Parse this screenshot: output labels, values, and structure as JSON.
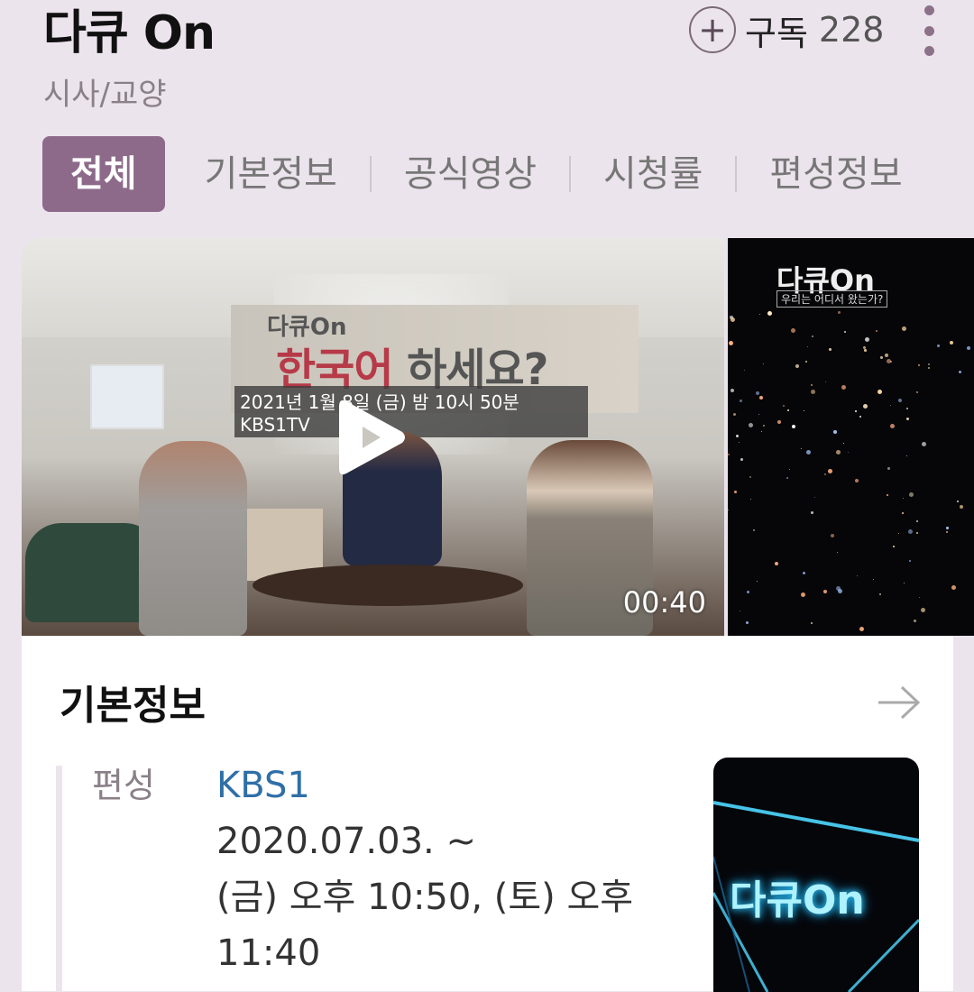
{
  "header": {
    "title": "다큐 On",
    "category": "시사/교양",
    "subscribe_label": "구독",
    "subscribe_count": "228"
  },
  "tabs": [
    {
      "label": "전체",
      "active": true
    },
    {
      "label": "기본정보",
      "active": false
    },
    {
      "label": "공식영상",
      "active": false
    },
    {
      "label": "시청률",
      "active": false
    },
    {
      "label": "편성정보",
      "active": false
    }
  ],
  "videos": [
    {
      "duration": "00:40",
      "sign_logo": "다큐On",
      "sign_title_red": "한국어",
      "sign_title_grey": "하세요?",
      "sign_date": "2021년 1월 8일 (금) 밤 10시 50분 KBS1TV"
    },
    {
      "logo": "다큐On",
      "subtitle": "우리는 어디서 왔는가?"
    }
  ],
  "info": {
    "section_title": "기본정보",
    "schedule_label": "편성",
    "channel": "KBS1",
    "start_date": "2020.07.03. ~",
    "airtime": "(금) 오후 10:50, (토) 오후",
    "airtime_cont": "11:40",
    "thumb_text": "다큐On"
  },
  "colors": {
    "background": "#ece4ec",
    "accent": "#8d6a8a",
    "link": "#2f6fa7"
  },
  "icons": {
    "subscribe": "plus-circle-icon",
    "more": "more-vertical-icon",
    "play": "play-icon",
    "arrow": "arrow-right-icon"
  }
}
